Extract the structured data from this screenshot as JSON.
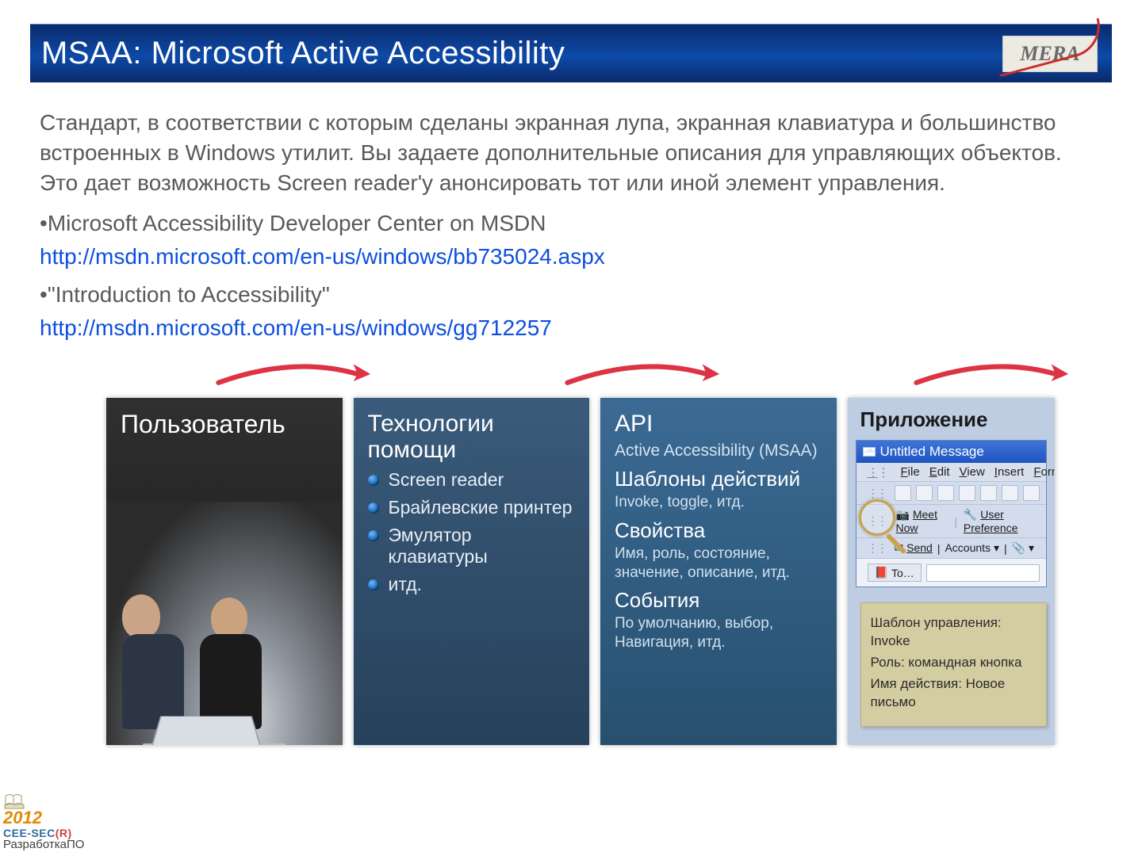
{
  "header": {
    "title": "MSAA: Microsoft Active Accessibility",
    "logo_text": "MERA"
  },
  "intro": "Стандарт, в соответствии с которым сделаны экранная лупа, экранная клавиатура и большинство встроенных в Windows утилит. Вы задаете дополнительные описания для управляющих объектов.  Это дает возможность Screen reader'у анонсировать тот или иной элемент управления.",
  "bullets": [
    {
      "label": "Microsoft Accessibility Developer Center on MSDN",
      "url": "http://msdn.microsoft.com/en-us/windows/bb735024.aspx"
    },
    {
      "label": "\"Introduction to Accessibility\"",
      "url": "http://msdn.microsoft.com/en-us/windows/gg712257"
    }
  ],
  "cards": {
    "user": {
      "title": "Пользователь"
    },
    "assist": {
      "title": "Технологии помощи",
      "items": [
        "Screen reader",
        "Брайлевские принтер",
        "Эмулятор клавиатуры",
        "итд."
      ]
    },
    "api": {
      "title": "API",
      "api_sub": "Active Accessibility (MSAA)",
      "sections": [
        {
          "h": "Шаблоны действий",
          "d": "Invoke, toggle, итд."
        },
        {
          "h": "Свойства",
          "d": "Имя, роль, состояние, значение, описание, итд."
        },
        {
          "h": "События",
          "d": "По умолчанию, выбор, Навигация, итд."
        }
      ]
    },
    "app": {
      "title": "Приложение",
      "win_title": "Untitled Message",
      "menus": [
        "File",
        "Edit",
        "View",
        "Insert",
        "Form"
      ],
      "row2_meet": "Meet Now",
      "row2_pref": "User Preference",
      "row3_send": "Send",
      "row3_accounts": "Accounts",
      "to_label": "To…",
      "note_lines": [
        "Шаблон управления: Invoke",
        "Роль: командная кнопка",
        "Имя действия: Новое письмо"
      ]
    }
  },
  "conference": {
    "year": "2012",
    "org_a": "CEE-SEC",
    "org_b": "(R)",
    "tag": "РазработкаПО"
  }
}
